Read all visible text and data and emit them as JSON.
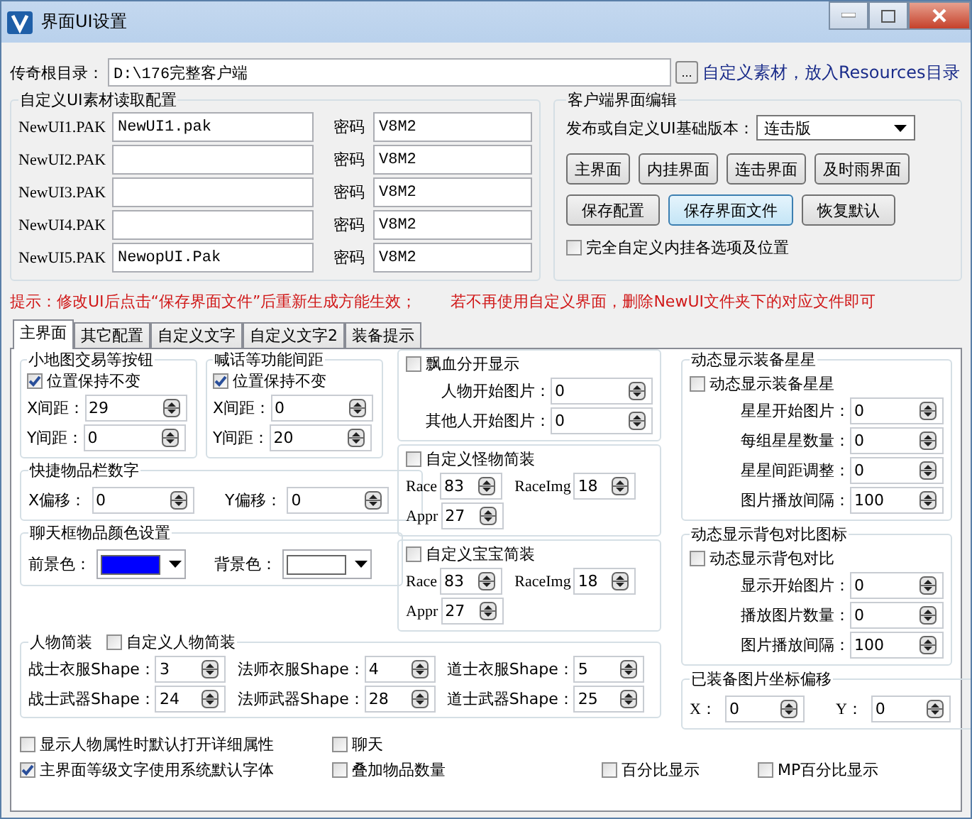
{
  "window": {
    "title": "界面UI设置"
  },
  "root_dir": {
    "label": "传奇根目录：",
    "value": "D:\\176完整客户端",
    "browse": "...",
    "link": "自定义素材，放入Resources目录"
  },
  "pak_config": {
    "title": "自定义UI素材读取配置",
    "rows": [
      {
        "label": "NewUI1.PAK",
        "file": "NewUI1.pak",
        "password_label": "密码",
        "password": "V8M2"
      },
      {
        "label": "NewUI2.PAK",
        "file": "",
        "password_label": "密码",
        "password": "V8M2"
      },
      {
        "label": "NewUI3.PAK",
        "file": "",
        "password_label": "密码",
        "password": "V8M2"
      },
      {
        "label": "NewUI4.PAK",
        "file": "",
        "password_label": "密码",
        "password": "V8M2"
      },
      {
        "label": "NewUI5.PAK",
        "file": "NewopUI.Pak",
        "password_label": "密码",
        "password": "V8M2"
      }
    ]
  },
  "client_edit": {
    "title": "客户端界面编辑",
    "version_label": "发布或自定义UI基础版本：",
    "version": "连击版",
    "buttons": [
      {
        "label": "主界面",
        "highlighted": false
      },
      {
        "label": "内挂界面",
        "highlighted": false
      },
      {
        "label": "连击界面",
        "highlighted": false
      },
      {
        "label": "及时雨界面",
        "highlighted": false
      }
    ],
    "buttons2": [
      {
        "label": "保存配置",
        "highlighted": false
      },
      {
        "label": "保存界面文件",
        "highlighted": true
      },
      {
        "label": "恢复默认",
        "highlighted": false
      }
    ],
    "checkbox": {
      "label": "完全自定义内挂各选项及位置",
      "checked": false
    }
  },
  "hint": {
    "left": "提示：修改UI后点击“保存界面文件”后重新生成方能生效；",
    "right": "若不再使用自定义界面，删除NewUI文件夹下的对应文件即可"
  },
  "tabs": [
    {
      "label": "主界面",
      "selected": true
    },
    {
      "label": "其它配置",
      "selected": false
    },
    {
      "label": "自定义文字",
      "selected": false
    },
    {
      "label": "自定义文字2",
      "selected": false
    },
    {
      "label": "装备提示",
      "selected": false
    }
  ],
  "panel": {
    "minimap": {
      "title": "小地图交易等按钮",
      "checkbox": {
        "label": "位置保持不变",
        "checked": true
      },
      "fields": [
        {
          "label": "X间距：",
          "value": "29"
        },
        {
          "label": "Y间距：",
          "value": "0"
        }
      ]
    },
    "shout": {
      "title": "喊话等功能间距",
      "checkbox": {
        "label": "位置保持不变",
        "checked": true
      },
      "fields": [
        {
          "label": "X间距：",
          "value": "0"
        },
        {
          "label": "Y间距：",
          "value": "20"
        }
      ]
    },
    "hotbar": {
      "title": "快捷物品栏数字",
      "fields": [
        {
          "label": "X偏移：",
          "value": "0"
        },
        {
          "label": "Y偏移：",
          "value": "0"
        }
      ]
    },
    "chat_color": {
      "title": "聊天框物品颜色设置",
      "pickers": [
        {
          "label": "前景色：",
          "color": "#0000ff"
        },
        {
          "label": "背景色：",
          "color": "#ffffff"
        }
      ]
    },
    "float_blood": {
      "checkbox": {
        "label": "飘血分开显示",
        "checked": false
      },
      "fields": [
        {
          "label": "人物开始图片：",
          "value": "0"
        },
        {
          "label": "其他人开始图片：",
          "value": "0"
        }
      ]
    },
    "monster": {
      "checkbox": {
        "label": "自定义怪物简装",
        "checked": false
      },
      "fields": [
        {
          "label": "Race",
          "value": "83"
        },
        {
          "label": "RaceImg",
          "value": "18"
        },
        {
          "label": "Appr",
          "value": "27"
        }
      ]
    },
    "pet": {
      "checkbox": {
        "label": "自定义宝宝简装",
        "checked": false
      },
      "fields": [
        {
          "label": "Race",
          "value": "83"
        },
        {
          "label": "RaceImg",
          "value": "18"
        },
        {
          "label": "Appr",
          "value": "27"
        }
      ]
    },
    "stars": {
      "title": "动态显示装备星星",
      "checkbox": {
        "label": "动态显示装备星星",
        "checked": false
      },
      "fields": [
        {
          "label": "星星开始图片：",
          "value": "0"
        },
        {
          "label": "每组星星数量：",
          "value": "0"
        },
        {
          "label": "星星间距调整：",
          "value": "0"
        },
        {
          "label": "图片播放间隔：",
          "value": "100"
        }
      ]
    },
    "bag": {
      "title": "动态显示背包对比图标",
      "checkbox": {
        "label": "动态显示背包对比",
        "checked": false
      },
      "fields": [
        {
          "label": "显示开始图片：",
          "value": "0"
        },
        {
          "label": "播放图片数量：",
          "value": "0"
        },
        {
          "label": "图片播放间隔：",
          "value": "100"
        }
      ]
    },
    "offset": {
      "title": "已装备图片坐标偏移",
      "fields": [
        {
          "label": "X：",
          "value": "0"
        },
        {
          "label": "Y：",
          "value": "0"
        }
      ]
    },
    "appearance": {
      "title": "人物简装",
      "checkbox": {
        "label": "自定义人物简装",
        "checked": false
      },
      "fields": [
        {
          "label": "战士衣服Shape：",
          "value": "3"
        },
        {
          "label": "法师衣服Shape：",
          "value": "4"
        },
        {
          "label": "道士衣服Shape：",
          "value": "5"
        },
        {
          "label": "战士武器Shape：",
          "value": "24"
        },
        {
          "label": "法师武器Shape：",
          "value": "28"
        },
        {
          "label": "道士武器Shape：",
          "value": "25"
        }
      ]
    },
    "options": [
      {
        "label": "显示人物属性时默认打开详细属性",
        "checked": false
      },
      {
        "label": "聊天",
        "checked": false
      },
      {
        "label": "主界面等级文字使用系统默认字体",
        "checked": true
      },
      {
        "label": "叠加物品数量",
        "checked": false
      },
      {
        "label": "百分比显示",
        "checked": false
      },
      {
        "label": "MP百分比显示",
        "checked": false
      }
    ]
  }
}
